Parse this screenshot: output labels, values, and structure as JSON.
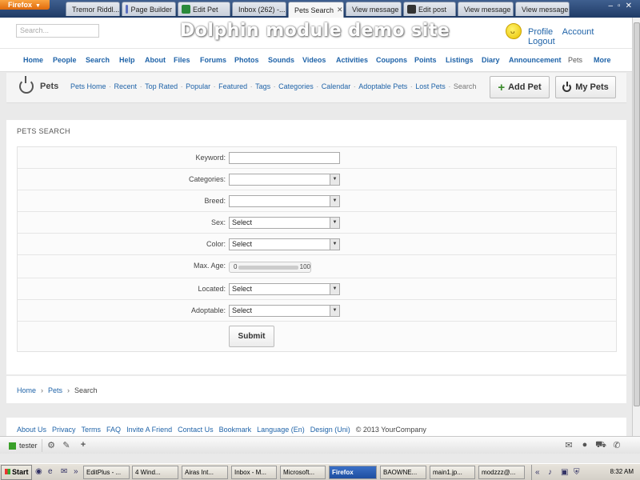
{
  "browser": {
    "menu_label": "Firefox",
    "tabs": [
      {
        "label": "Tremor Riddl...",
        "color": "#d22"
      },
      {
        "label": "Page Builder",
        "color": "#5a6fc0"
      },
      {
        "label": "Edit Pet",
        "color": "#2a8a3a"
      },
      {
        "label": "Inbox (262) -...",
        "color": "#c33"
      },
      {
        "label": "Pets Search",
        "color": "#5a6fc0"
      },
      {
        "label": "View message",
        "color": "#333"
      },
      {
        "label": "Edit post",
        "color": "#333"
      },
      {
        "label": "View message",
        "color": "#333"
      },
      {
        "label": "View message",
        "color": "#333"
      }
    ]
  },
  "header": {
    "search_placeholder": "Search...",
    "site_title": "Dolphin module demo site",
    "links": [
      "Profile",
      "Account",
      "Logout"
    ]
  },
  "nav": {
    "items": [
      "Home",
      "People",
      "Search",
      "Help",
      "About",
      "Files",
      "Forums",
      "Photos",
      "Sounds",
      "Videos",
      "Activities",
      "Coupons",
      "Points",
      "Listings",
      "Diary",
      "Announcement",
      "Pets",
      "More"
    ]
  },
  "module": {
    "title": "Pets",
    "links": [
      "Pets Home",
      "Recent",
      "Top Rated",
      "Popular",
      "Featured",
      "Tags",
      "Categories",
      "Calendar",
      "Adoptable Pets",
      "Lost Pets"
    ],
    "current": "Search",
    "add_button": "Add Pet",
    "my_button": "My Pets"
  },
  "search_form": {
    "title": "PETS SEARCH",
    "keyword_label": "Keyword:",
    "keyword_value": "",
    "categories_label": "Categories:",
    "categories_value": "",
    "breed_label": "Breed:",
    "breed_value": "",
    "sex_label": "Sex:",
    "sex_value": "Select",
    "color_label": "Color:",
    "color_value": "Select",
    "age_label": "Max. Age:",
    "age_min": "0",
    "age_max": "100",
    "located_label": "Located:",
    "located_value": "Select",
    "adoptable_label": "Adoptable:",
    "adoptable_value": "Select",
    "submit_label": "Submit"
  },
  "breadcrumb": {
    "items": [
      "Home",
      "Pets"
    ],
    "current": "Search"
  },
  "footer": {
    "links": [
      "About Us",
      "Privacy",
      "Terms",
      "FAQ",
      "Invite A Friend",
      "Contact Us",
      "Bookmark",
      "Language (En)",
      "Design (Uni)"
    ],
    "copyright": "© 2013 YourCompany"
  },
  "toolbar": {
    "user": "tester"
  },
  "taskbar": {
    "start": "Start",
    "tasks": [
      "EditPlus - ...",
      "4 Wind...",
      "Airas Int...",
      "Inbox - M...",
      "Microsoft...",
      "Firefox",
      "BAOWNE...",
      "main1.jp...",
      "modzzz@..."
    ],
    "clock": "8:32 AM"
  },
  "colors": {
    "link": "#1f63a8",
    "accent_green": "#3a8a2a",
    "firefox_orange": "#e06a0b"
  }
}
